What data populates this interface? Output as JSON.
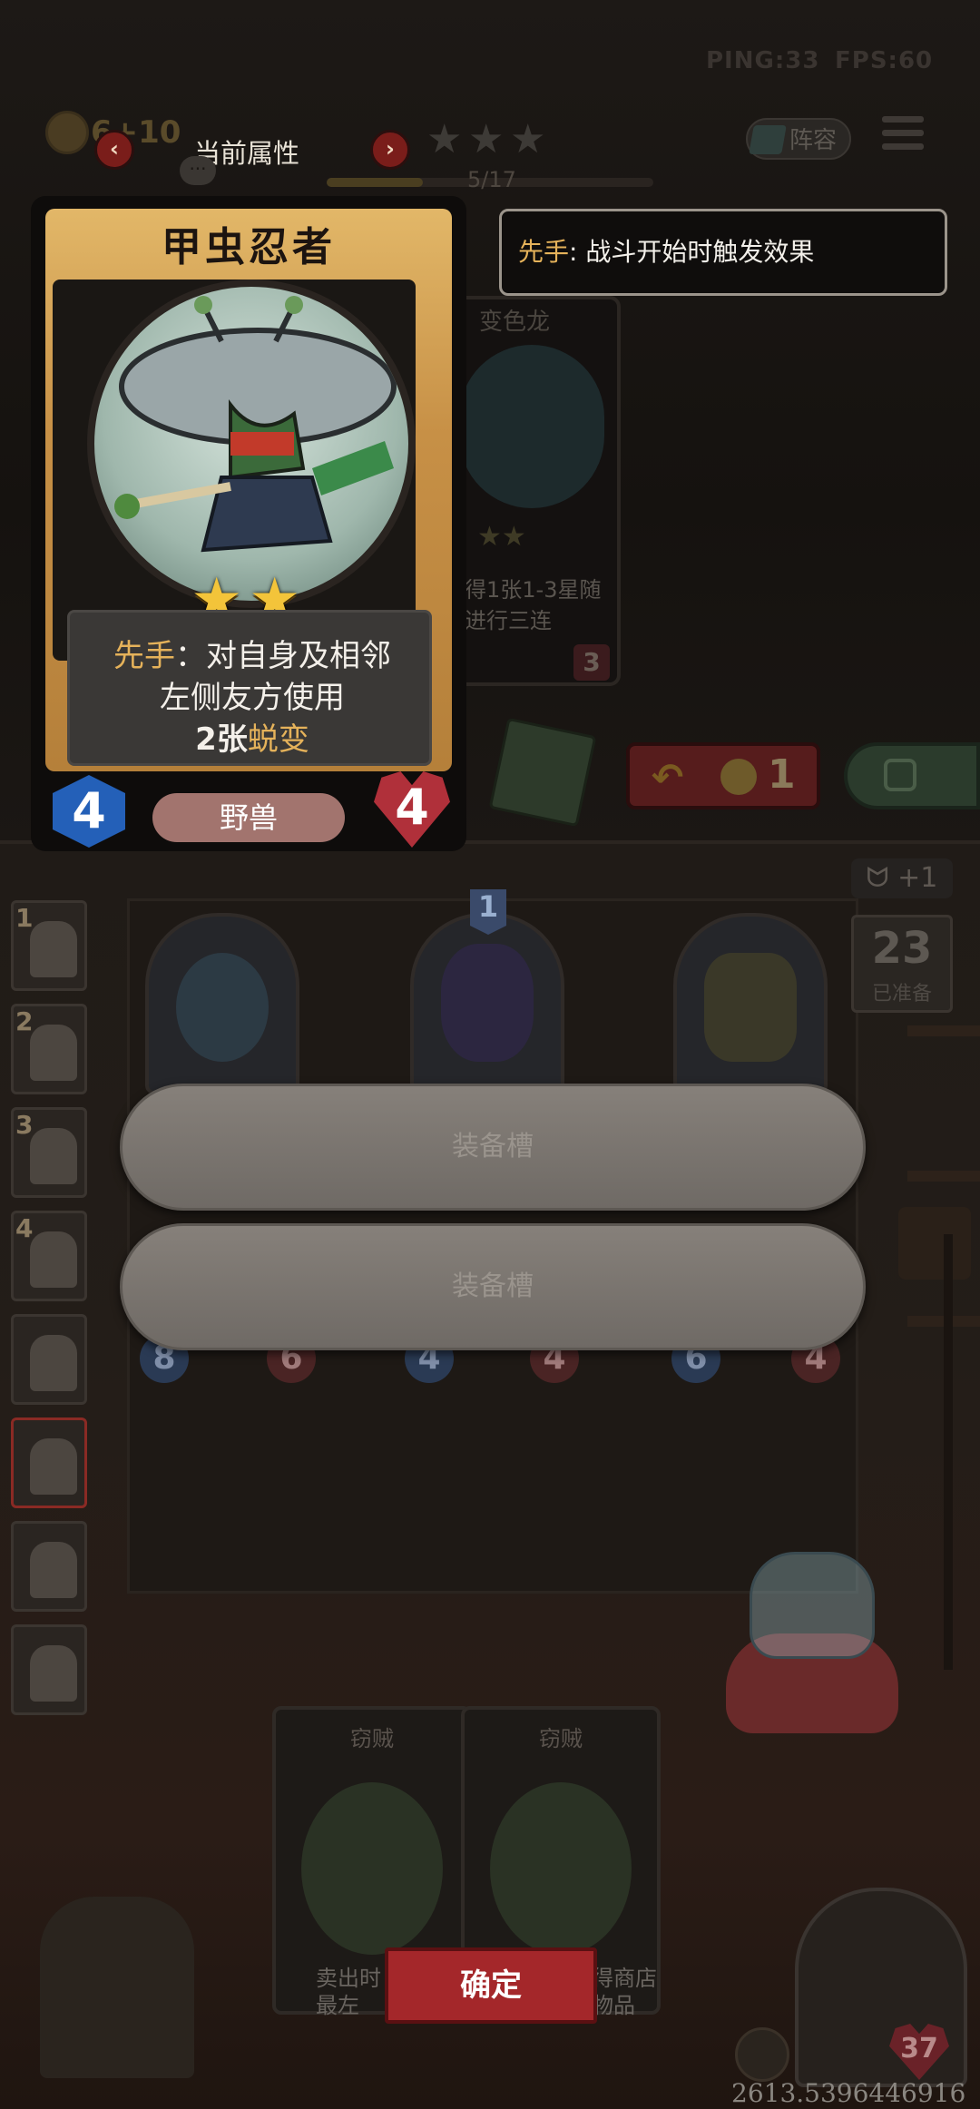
{
  "hud": {
    "ping": "PING:33",
    "fps": "FPS:60"
  },
  "header": {
    "gold": "6+10",
    "attr_title": "当前属性",
    "arrow_left": "‹",
    "arrow_right": "›",
    "stars": [
      "★",
      "★",
      "★"
    ],
    "progress": "5/17",
    "progress_fraction": 0.294,
    "lineup": "阵容",
    "chat": "···"
  },
  "tooltip": {
    "keyword": "先手",
    "text": ": 战斗开始时触发效果"
  },
  "back_card": {
    "name": "变色龙",
    "stars": "★★",
    "text_line1": "得1张1-3星随",
    "text_line2": "进行三连",
    "cost": "3"
  },
  "card": {
    "name": "甲虫忍者",
    "stars": [
      "★",
      "★"
    ],
    "desc_keyword": "先手",
    "desc_line1": "：对自身及相邻",
    "desc_line2": "左侧友方使用",
    "desc_line3_prefix": "2张",
    "desc_line3_keyword": "蜕变",
    "attack": "4",
    "health": "4",
    "tribe": "野兽"
  },
  "shop_controls": {
    "refresh_arrow": "↶",
    "refresh_cost": "1"
  },
  "team": {
    "slots": [
      {
        "num": "1"
      },
      {
        "num": "2"
      },
      {
        "num": "3"
      },
      {
        "num": "4"
      },
      {
        "num": ""
      },
      {
        "num": ""
      },
      {
        "num": ""
      },
      {
        "num": ""
      }
    ]
  },
  "board": {
    "turn_badge": "ᗢ +1",
    "ready_count": "23",
    "ready_label": "已准备",
    "minion_level": "1",
    "minions": [
      {
        "atk": "8",
        "hp": "6"
      },
      {
        "atk": "4",
        "hp": "4"
      },
      {
        "atk": "6",
        "hp": "4"
      }
    ],
    "equip_slot_1": "装备槽",
    "equip_slot_2": "装备槽"
  },
  "sell": {
    "card1_name": "窃贼",
    "card2_name": "窃贼",
    "text1": "卖出时",
    "text2": "最左",
    "text3": "得商店",
    "text4": "物品",
    "confirm": "确定"
  },
  "hero": {
    "hp": "37",
    "coords": "2613.5396446916"
  }
}
